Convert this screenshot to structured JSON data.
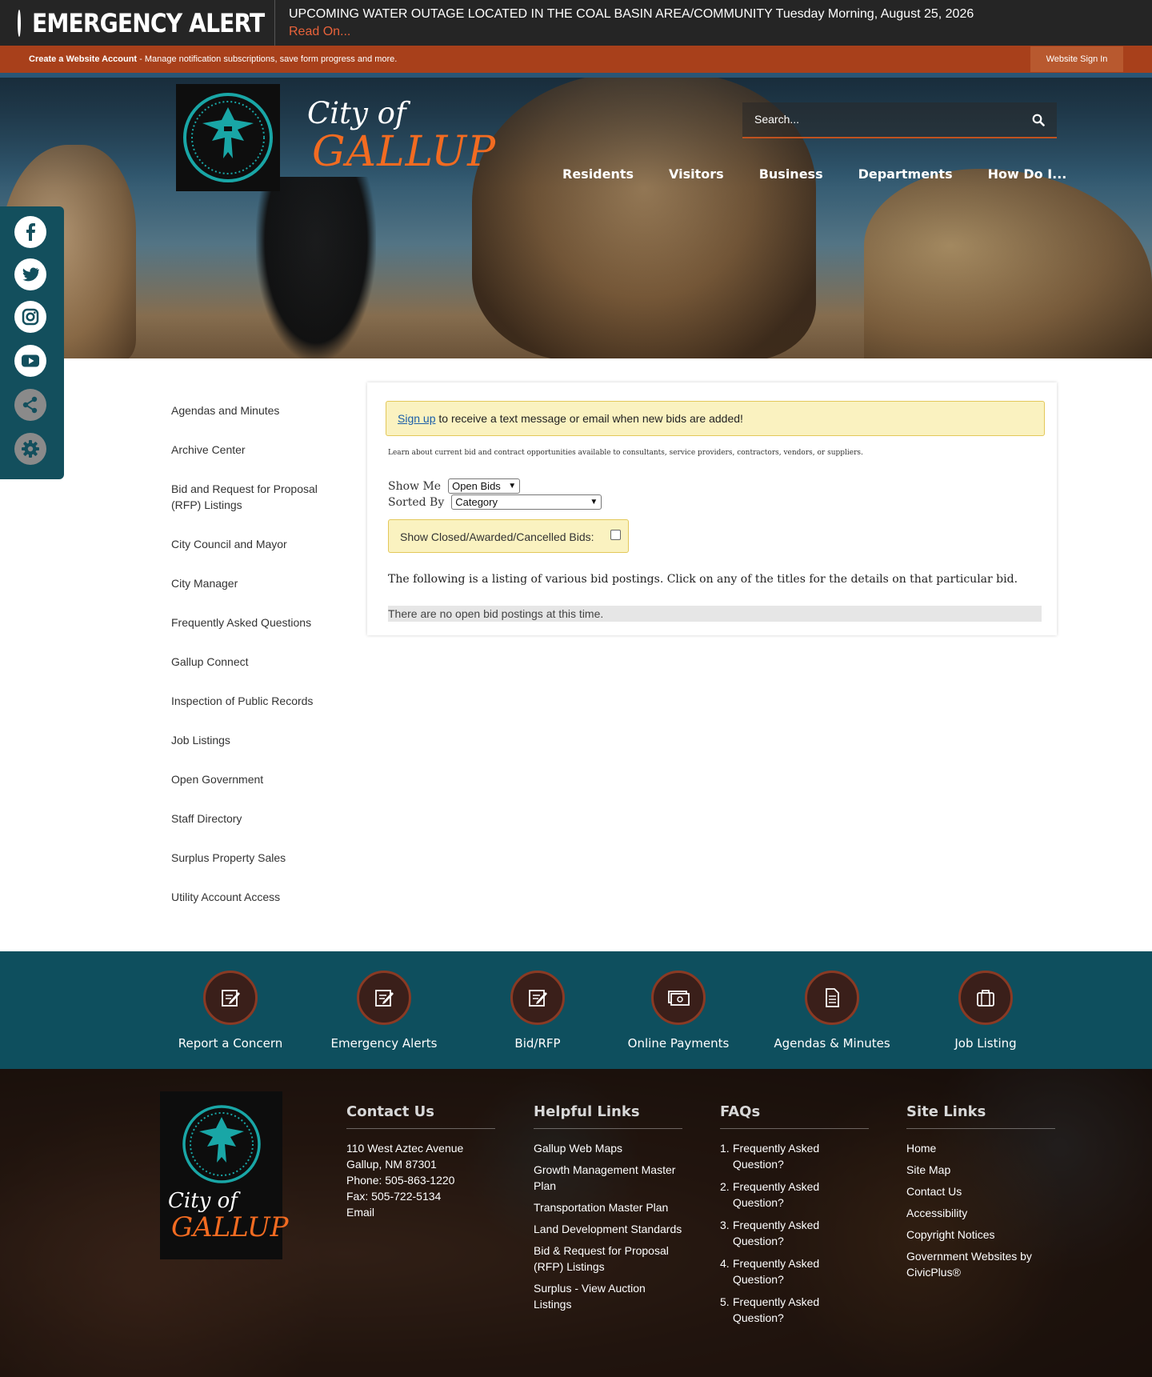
{
  "alert": {
    "title": "EMERGENCY ALERT",
    "message": "UPCOMING WATER OUTAGE LOCATED IN THE COAL BASIN AREA/COMMUNITY Tuesday Morning, August 25, 2026",
    "link": "Read On..."
  },
  "account_bar": {
    "create_label": "Create a Website Account",
    "create_desc": " - Manage notification subscriptions, save form progress and more.",
    "signin_label": "Website Sign In"
  },
  "header": {
    "city_of": "City of",
    "city_name": "GALLUP",
    "search_placeholder": "Search...",
    "nav": [
      "Residents",
      "Visitors",
      "Business",
      "Departments",
      "How Do I..."
    ]
  },
  "social": [
    "facebook-icon",
    "twitter-icon",
    "instagram-icon",
    "youtube-icon",
    "share-icon",
    "settings-icon"
  ],
  "side_nav": [
    "Agendas and Minutes",
    "Archive Center",
    "Bid and Request for Proposal (RFP) Listings",
    "City Council and Mayor",
    "City Manager",
    "Frequently Asked Questions",
    "Gallup Connect",
    "Inspection of Public Records",
    "Job Listings",
    "Open Government",
    "Staff Directory",
    "Surplus Property Sales",
    "Utility Account Access"
  ],
  "bids": {
    "signup_link": "Sign up",
    "signup_text": " to receive a text message or email when new bids are added!",
    "intro": "Learn about current bid and contract opportunities available to consultants, service providers, contractors, vendors, or suppliers.",
    "show_me_label": "Show Me",
    "show_me_value": "Open Bids",
    "sorted_by_label": "Sorted By",
    "sorted_by_value": "Category",
    "closed_label": "Show Closed/Awarded/Cancelled Bids:",
    "listing_text": "The following is a listing of various bid postings. Click on any of the titles for the details on that particular bid.",
    "empty_text": "There are no open bid postings at this time."
  },
  "quick_links": [
    {
      "label": "Report a Concern",
      "icon": "edit-icon"
    },
    {
      "label": "Emergency Alerts",
      "icon": "edit-icon"
    },
    {
      "label": "Bid/RFP",
      "icon": "edit-icon"
    },
    {
      "label": "Online Payments",
      "icon": "payment-icon"
    },
    {
      "label": "Agendas & Minutes",
      "icon": "document-icon"
    },
    {
      "label": "Job Listing",
      "icon": "briefcase-icon"
    }
  ],
  "footer": {
    "logo_city_of": "City of",
    "logo_city_name": "GALLUP",
    "contact": {
      "heading": "Contact Us",
      "lines": [
        "110 West Aztec Avenue",
        "Gallup, NM 87301",
        "Phone: 505-863-1220",
        "Fax: 505-722-5134",
        "Email"
      ]
    },
    "helpful": {
      "heading": "Helpful Links",
      "links": [
        "Gallup Web Maps",
        "Growth Management Master Plan",
        "Transportation Master Plan",
        "Land Development Standards",
        "Bid & Request for Proposal (RFP) Listings",
        "Surplus - View Auction Listings"
      ]
    },
    "faqs": {
      "heading": "FAQs",
      "items": [
        "Frequently Asked Question?",
        "Frequently Asked Question?",
        "Frequently Asked Question?",
        "Frequently Asked Question?",
        "Frequently Asked Question?"
      ]
    },
    "site_links": {
      "heading": "Site Links",
      "links": [
        "Home",
        "Site Map",
        "Contact Us",
        "Accessibility",
        "Copyright Notices",
        "Government Websites by CivicPlus®"
      ]
    }
  },
  "colors": {
    "alert_bg": "#252525",
    "account_bar": "#a8401b",
    "brand_orange": "#f26b21",
    "teal": "#0e4f5e",
    "callout_bg": "#faf2c0"
  }
}
